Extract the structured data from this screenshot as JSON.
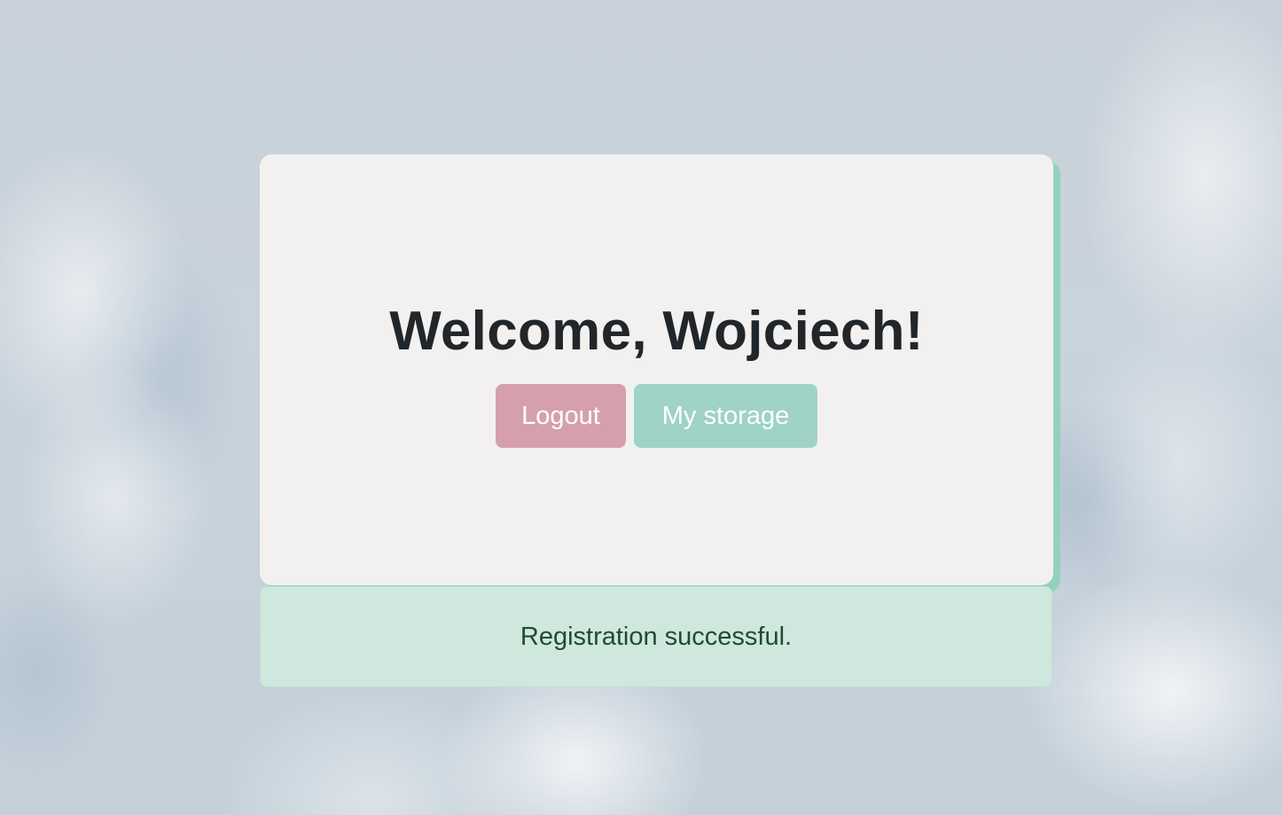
{
  "welcome": {
    "heading": "Welcome, Wojciech!"
  },
  "actions": {
    "logout_label": "Logout",
    "storage_label": "My storage"
  },
  "alert": {
    "message": "Registration successful."
  },
  "colors": {
    "card_background": "#f2f1f0",
    "card_accent": "#93d1bd",
    "logout_button": "#d5a0ab",
    "storage_button": "#9ed3c5",
    "alert_background": "#d0e7dd",
    "alert_text": "#1f4a38"
  }
}
